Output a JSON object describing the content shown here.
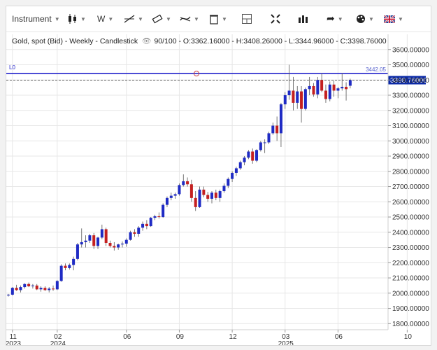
{
  "toolbar": {
    "instrument_label": "Instrument",
    "period_label": "W",
    "items": [
      {
        "name": "instrument-dropdown",
        "icon": "dropdown"
      },
      {
        "name": "candle-type-icon",
        "icon": "candlestick-icon"
      },
      {
        "name": "period-dropdown",
        "icon": "period"
      },
      {
        "name": "draw-line-icon",
        "icon": "line-tool-icon"
      },
      {
        "name": "ruler-icon",
        "icon": "ruler-icon"
      },
      {
        "name": "indicator-icon",
        "icon": "indicator-icon"
      },
      {
        "name": "trash-icon",
        "icon": "trash-icon"
      },
      {
        "name": "crosshair-icon",
        "icon": "crosshair-icon"
      },
      {
        "name": "fullscreen-icon",
        "icon": "expand-icon"
      },
      {
        "name": "chart-type-icon",
        "icon": "bars-icon"
      },
      {
        "name": "share-icon",
        "icon": "share-arrow-icon"
      },
      {
        "name": "theme-icon",
        "icon": "palette-icon"
      },
      {
        "name": "language-flag-icon",
        "icon": "uk-flag-icon"
      }
    ]
  },
  "info_line": "Gold, spot (Bid) - Weekly - Candlestick",
  "info_values": "90/100 - O:3362.16000 - H:3408.26000 - L:3344.96000 - C:3398.76000",
  "hline": {
    "label": "L0",
    "value_label": "3442.05",
    "value": 3442.05,
    "color": "#2222cc"
  },
  "last_price": {
    "label": "3398.76000",
    "value": 3398.76,
    "color": "#0b2aa8"
  },
  "colors": {
    "up": "#1f2bc4",
    "down": "#c42020",
    "wick": "#555555"
  },
  "chart_data": {
    "type": "candlestick",
    "title": "Gold, spot (Bid) - Weekly - Candlestick",
    "ylim": [
      1760,
      3700
    ],
    "yticks": [
      1800,
      1900,
      2000,
      2100,
      2200,
      2300,
      2400,
      2500,
      2600,
      2700,
      2800,
      2900,
      3000,
      3100,
      3200,
      3300,
      3400,
      3500,
      3600
    ],
    "ytick_labels": [
      "1800.00000",
      "1900.00000",
      "2000.00000",
      "2100.00000",
      "2200.00000",
      "2300.00000",
      "2400.00000",
      "2500.00000",
      "2600.00000",
      "2700.00000",
      "2800.00000",
      "2900.00000",
      "3000.00000",
      "3100.00000",
      "3200.00000",
      "3300.00000",
      "3400.00000",
      "3500.00000",
      "3600.00000"
    ],
    "xticks": [
      {
        "label": "11",
        "year": "2023",
        "index": 1
      },
      {
        "label": "02",
        "year": "2024",
        "index": 12
      },
      {
        "label": "06",
        "year": "",
        "index": 29
      },
      {
        "label": "09",
        "year": "",
        "index": 42
      },
      {
        "label": "12",
        "year": "",
        "index": 55
      },
      {
        "label": "03",
        "year": "2025",
        "index": 68
      },
      {
        "label": "06",
        "year": "",
        "index": 81
      },
      {
        "label": "10",
        "year": "",
        "index": 98
      }
    ],
    "candles": [
      [
        1985,
        1995,
        1978,
        1990
      ],
      [
        1990,
        2040,
        1985,
        2035
      ],
      [
        2035,
        2055,
        2015,
        2020
      ],
      [
        2020,
        2050,
        2005,
        2040
      ],
      [
        2040,
        2065,
        2030,
        2060
      ],
      [
        2060,
        2070,
        2040,
        2045
      ],
      [
        2045,
        2060,
        2030,
        2050
      ],
      [
        2050,
        2060,
        2020,
        2025
      ],
      [
        2025,
        2045,
        2010,
        2035
      ],
      [
        2035,
        2045,
        2015,
        2020
      ],
      [
        2020,
        2040,
        2005,
        2030
      ],
      [
        2030,
        2050,
        2015,
        2025
      ],
      [
        2025,
        2085,
        2020,
        2080
      ],
      [
        2080,
        2190,
        2075,
        2180
      ],
      [
        2180,
        2195,
        2150,
        2165
      ],
      [
        2165,
        2195,
        2155,
        2185
      ],
      [
        2185,
        2240,
        2150,
        2225
      ],
      [
        2225,
        2330,
        2215,
        2320
      ],
      [
        2320,
        2425,
        2300,
        2335
      ],
      [
        2335,
        2380,
        2300,
        2345
      ],
      [
        2345,
        2390,
        2330,
        2380
      ],
      [
        2380,
        2395,
        2290,
        2310
      ],
      [
        2310,
        2370,
        2290,
        2365
      ],
      [
        2365,
        2450,
        2355,
        2420
      ],
      [
        2420,
        2430,
        2310,
        2330
      ],
      [
        2330,
        2345,
        2300,
        2310
      ],
      [
        2310,
        2335,
        2280,
        2300
      ],
      [
        2300,
        2325,
        2285,
        2320
      ],
      [
        2320,
        2340,
        2300,
        2325
      ],
      [
        2325,
        2360,
        2305,
        2350
      ],
      [
        2350,
        2410,
        2345,
        2400
      ],
      [
        2400,
        2420,
        2370,
        2390
      ],
      [
        2390,
        2440,
        2370,
        2430
      ],
      [
        2430,
        2470,
        2410,
        2455
      ],
      [
        2455,
        2480,
        2420,
        2440
      ],
      [
        2440,
        2500,
        2435,
        2495
      ],
      [
        2495,
        2515,
        2480,
        2505
      ],
      [
        2505,
        2530,
        2490,
        2500
      ],
      [
        2500,
        2590,
        2495,
        2580
      ],
      [
        2580,
        2635,
        2565,
        2625
      ],
      [
        2625,
        2660,
        2610,
        2640
      ],
      [
        2640,
        2660,
        2620,
        2650
      ],
      [
        2650,
        2720,
        2640,
        2710
      ],
      [
        2710,
        2780,
        2700,
        2735
      ],
      [
        2735,
        2760,
        2700,
        2715
      ],
      [
        2715,
        2745,
        2600,
        2625
      ],
      [
        2625,
        2670,
        2540,
        2565
      ],
      [
        2565,
        2700,
        2560,
        2680
      ],
      [
        2680,
        2700,
        2630,
        2645
      ],
      [
        2645,
        2665,
        2600,
        2620
      ],
      [
        2620,
        2670,
        2590,
        2660
      ],
      [
        2660,
        2680,
        2610,
        2625
      ],
      [
        2625,
        2680,
        2600,
        2670
      ],
      [
        2670,
        2720,
        2660,
        2705
      ],
      [
        2705,
        2760,
        2690,
        2750
      ],
      [
        2750,
        2800,
        2730,
        2790
      ],
      [
        2790,
        2830,
        2770,
        2820
      ],
      [
        2820,
        2870,
        2810,
        2860
      ],
      [
        2860,
        2900,
        2840,
        2890
      ],
      [
        2890,
        2940,
        2880,
        2930
      ],
      [
        2930,
        2950,
        2850,
        2870
      ],
      [
        2870,
        2945,
        2860,
        2940
      ],
      [
        2940,
        3000,
        2930,
        2990
      ],
      [
        2990,
        3010,
        2920,
        2990
      ],
      [
        2990,
        3060,
        2980,
        3050
      ],
      [
        3050,
        3120,
        3040,
        3100
      ],
      [
        3100,
        3160,
        3000,
        3050
      ],
      [
        3050,
        3250,
        2960,
        3240
      ],
      [
        3240,
        3320,
        3210,
        3300
      ],
      [
        3300,
        3500,
        3270,
        3330
      ],
      [
        3330,
        3420,
        3200,
        3250
      ],
      [
        3250,
        3360,
        3210,
        3325
      ],
      [
        3325,
        3360,
        3120,
        3210
      ],
      [
        3210,
        3350,
        3200,
        3340
      ],
      [
        3340,
        3420,
        3300,
        3360
      ],
      [
        3360,
        3380,
        3290,
        3305
      ],
      [
        3305,
        3420,
        3280,
        3400
      ],
      [
        3400,
        3445,
        3320,
        3330
      ],
      [
        3330,
        3370,
        3250,
        3275
      ],
      [
        3275,
        3390,
        3260,
        3370
      ],
      [
        3370,
        3395,
        3290,
        3330
      ],
      [
        3330,
        3355,
        3280,
        3345
      ],
      [
        3345,
        3445,
        3330,
        3355
      ],
      [
        3355,
        3385,
        3265,
        3340
      ],
      [
        3362.16,
        3408.26,
        3344.96,
        3398.76
      ]
    ]
  }
}
